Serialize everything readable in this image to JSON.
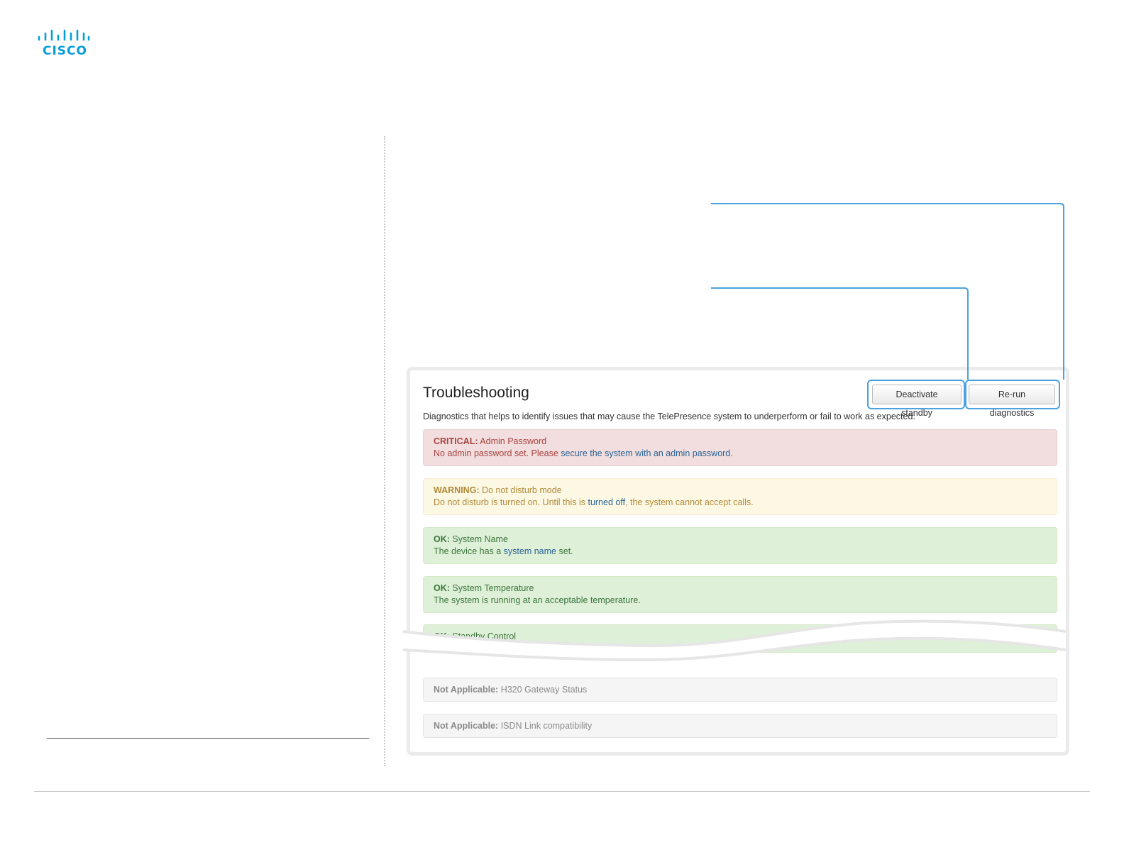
{
  "brand": {
    "logo_text": "CISCO",
    "color": "#049fd9"
  },
  "troubleshooting": {
    "title": "Troubleshooting",
    "description": "Diagnostics that helps to identify issues that may cause the TelePresence system to underperform or fail to work as expected.",
    "buttons": {
      "deactivate_standby": "Deactivate standby",
      "rerun_diagnostics": "Re-run diagnostics"
    },
    "alerts": [
      {
        "level": "CRITICAL:",
        "name": "Admin Password",
        "text_before": "No admin password set. Please ",
        "link": "secure the system with an admin password",
        "text_after": "."
      },
      {
        "level": "WARNING:",
        "name": "Do not disturb mode",
        "text_before": "Do not disturb is turned on. Until this is ",
        "link": "turned off",
        "text_after": ", the system cannot accept calls."
      },
      {
        "level": "OK:",
        "name": "System Name",
        "text_before": "The device has a ",
        "link": "system name",
        "text_after": " set."
      },
      {
        "level": "OK:",
        "name": "System Temperature",
        "text_before": "The system is running at an acceptable temperature.",
        "link": "",
        "text_after": ""
      },
      {
        "level": "OK:",
        "name": "Standby Control"
      },
      {
        "level": "Not Applicable:",
        "name": "H320 Gateway Status"
      },
      {
        "level": "Not Applicable:",
        "name": "ISDN Link compatibility"
      }
    ]
  },
  "colors": {
    "critical": "#a94442",
    "warning": "#b08a3a",
    "ok": "#3c763d",
    "na": "#8a8a8a",
    "callout": "#4aa3df"
  }
}
